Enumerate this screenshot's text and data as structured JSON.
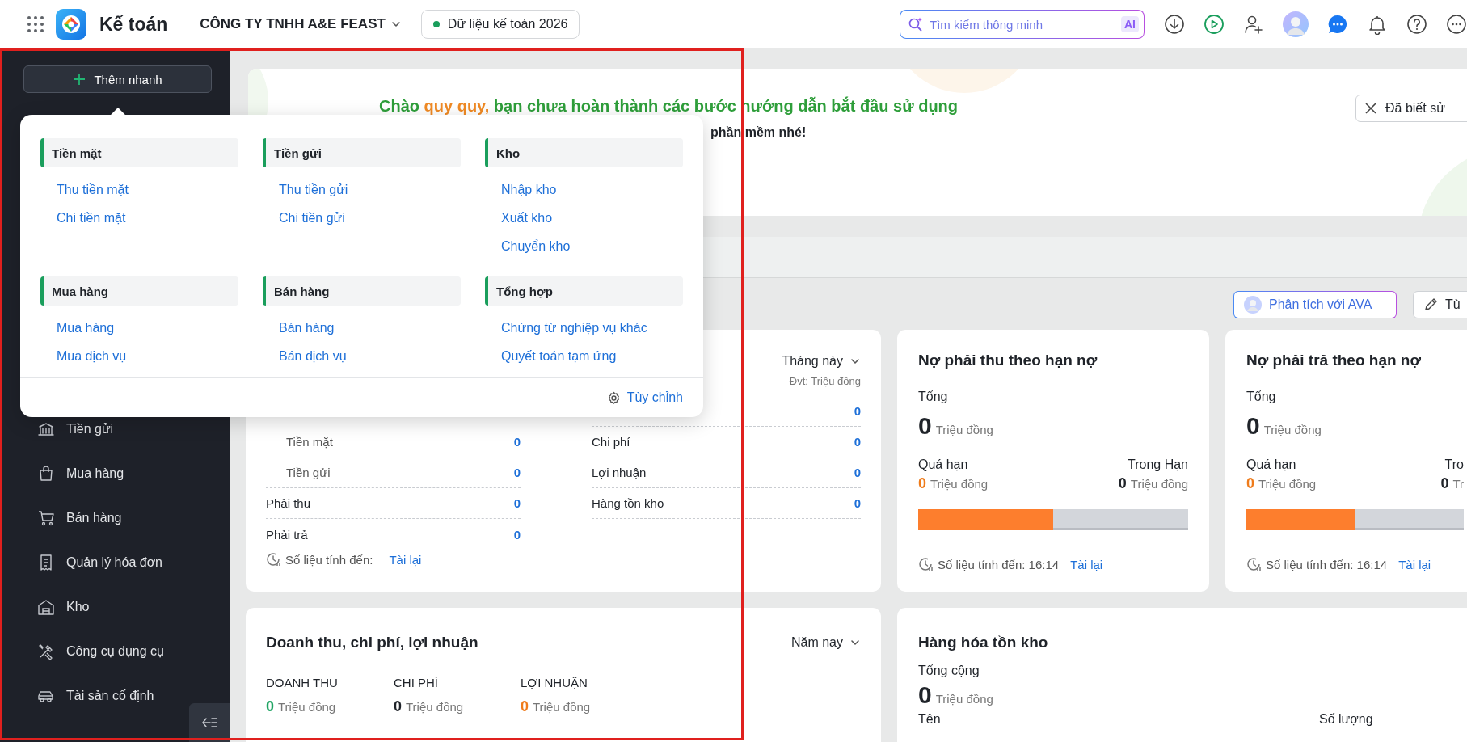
{
  "topbar": {
    "app_name": "Kế toán",
    "company": "CÔNG TY TNHH A&E FEAST",
    "data_badge": {
      "label": "Dữ liệu kế toán 2026",
      "color": "#1a9e5c"
    },
    "search": {
      "placeholder": "Tìm kiếm thông minh",
      "badge": "AI"
    }
  },
  "sidebar": {
    "quick_add": "Thêm nhanh",
    "items": [
      {
        "label": "Tiền gửi"
      },
      {
        "label": "Mua hàng"
      },
      {
        "label": "Bán hàng"
      },
      {
        "label": "Quản lý hóa đơn"
      },
      {
        "label": "Kho"
      },
      {
        "label": "Công cụ dụng cụ"
      },
      {
        "label": "Tài sản cố định"
      }
    ]
  },
  "quick_add_menu": {
    "sections": [
      {
        "title": "Tiền mặt",
        "links": [
          "Thu tiền mặt",
          "Chi tiền mặt"
        ]
      },
      {
        "title": "Tiền gửi",
        "links": [
          "Thu tiền gửi",
          "Chi tiền gửi"
        ]
      },
      {
        "title": "Kho",
        "links": [
          "Nhập kho",
          "Xuất kho",
          "Chuyển kho"
        ]
      },
      {
        "title": "Mua hàng",
        "links": [
          "Mua hàng",
          "Mua dịch vụ"
        ]
      },
      {
        "title": "Bán hàng",
        "links": [
          "Bán hàng",
          "Bán dịch vụ"
        ]
      },
      {
        "title": "Tổng hợp",
        "links": [
          "Chứng từ nghiệp vụ khác",
          "Quyết toán tạm ứng"
        ]
      }
    ],
    "customize": "Tùy chỉnh"
  },
  "banner": {
    "greeting_before": "Chào",
    "user_name": "quy quy,",
    "greeting_after": "bạn chưa hoàn thành các bước hướng dẫn bắt đầu sử dụng",
    "subline": "phần mềm nhé!",
    "dismiss": "Đã biết sử"
  },
  "toolbar": {
    "analyze": "Phân tích với AVA",
    "customize": "Tù"
  },
  "summary_card": {
    "period": "Tháng này",
    "unit_note": "Đvt: Triệu đồng",
    "left_rows": [
      {
        "label": "Tiền mặt",
        "value": "0",
        "kind": "sub"
      },
      {
        "label": "Tiền gửi",
        "value": "0",
        "kind": "sub"
      },
      {
        "label": "Phải thu",
        "value": "0",
        "kind": "main"
      },
      {
        "label": "Phải trả",
        "value": "0",
        "kind": "main"
      }
    ],
    "right_rows": [
      {
        "value": "0"
      },
      {
        "label": "Chi phí",
        "value": "0"
      },
      {
        "label": "Lợi nhuận",
        "value": "0"
      },
      {
        "label": "Hàng tồn kho",
        "value": "0"
      }
    ],
    "footer": "Số liệu tính đến:",
    "reload": "Tài lại"
  },
  "debt_cards": [
    {
      "title": "Nợ phải thu theo hạn nợ",
      "total_label": "Tổng",
      "total": "0",
      "unit": "Triệu đồng",
      "overdue_label": "Quá hạn",
      "overdue": "0",
      "overdue_unit": "Triệu đồng",
      "in_term_label": "Trong Hạn",
      "in_term": "0",
      "in_term_unit": "Triệu đồng",
      "level": 0.5,
      "footer": "Số liệu tính đến: 16:14",
      "reload": "Tài lại"
    },
    {
      "title": "Nợ phải trả theo hạn nợ",
      "total_label": "Tổng",
      "total": "0",
      "unit": "Triệu đồng",
      "overdue_label": "Quá hạn",
      "overdue": "0",
      "overdue_unit": "Triệu đồng",
      "in_term_label": "Tro",
      "in_term": "0",
      "in_term_unit": "Tr",
      "level": 0.5,
      "footer": "Số liệu tính đến: 16:14",
      "reload": "Tài lại"
    }
  ],
  "profit_card": {
    "title": "Doanh thu, chi phí, lợi nhuận",
    "period": "Năm nay",
    "metrics": [
      {
        "label": "DOANH THU",
        "value": "0",
        "unit": "Triệu đồng",
        "color": "#1fa463"
      },
      {
        "label": "CHI PHÍ",
        "value": "0",
        "unit": "Triệu đồng",
        "color": "#1f2329"
      },
      {
        "label": "LỢI NHUẬN",
        "value": "0",
        "unit": "Triệu đồng",
        "color": "#ef7b1a"
      }
    ]
  },
  "stock_card": {
    "title": "Hàng hóa tồn kho",
    "total_label": "Tổng cộng",
    "total": "0",
    "unit": "Triệu đồng",
    "columns": [
      "Tên",
      "Số lượng"
    ]
  }
}
